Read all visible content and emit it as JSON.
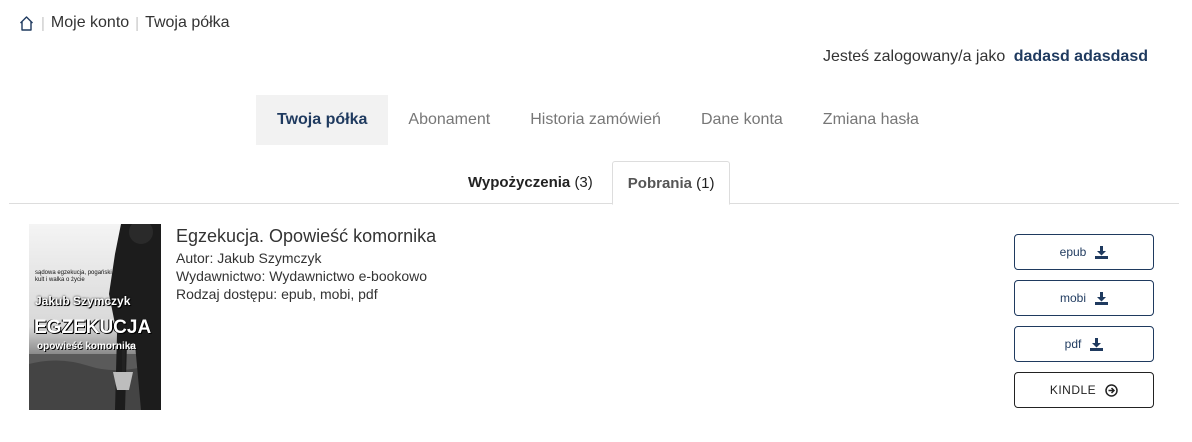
{
  "breadcrumb": {
    "home_icon": "home-icon",
    "items": [
      "Moje konto",
      "Twoja półka"
    ]
  },
  "account": {
    "logged_in_text": "Jesteś zalogowany/a jako",
    "user_name": "dadasd adasdasd"
  },
  "main_tabs": [
    {
      "label": "Twoja półka",
      "active": true
    },
    {
      "label": "Abonament",
      "active": false
    },
    {
      "label": "Historia zamówień",
      "active": false
    },
    {
      "label": "Dane konta",
      "active": false
    },
    {
      "label": "Zmiana hasła",
      "active": false
    }
  ],
  "sub_tabs": [
    {
      "label": "Wypożyczenia",
      "count": "(3)",
      "active": false
    },
    {
      "label": "Pobrania",
      "count": "(1)",
      "active": true
    }
  ],
  "book": {
    "title": "Egzekucja. Opowieść komornika",
    "author_line": "Autor: Jakub Szymczyk",
    "publisher_line": "Wydawnictwo: Wydawnictwo e-bookowo",
    "access_line": "Rodzaj dostępu: epub, mobi, pdf",
    "cover": {
      "tagline": "sądowa egzekucja, pogański kult i walka o życie",
      "author": "Jakub Szymczyk",
      "title": "EGZEKUCJA",
      "subtitle": "opowieść komornika"
    },
    "downloads": [
      {
        "label": "epub",
        "icon": "download-icon"
      },
      {
        "label": "mobi",
        "icon": "download-icon"
      },
      {
        "label": "pdf",
        "icon": "download-icon"
      }
    ],
    "kindle": {
      "label": "KINDLE",
      "icon": "arrow-circle-right-icon"
    }
  },
  "colors": {
    "accent": "#1f3a5f",
    "tab_active_bg": "#f2f2f2",
    "muted_text": "#777777",
    "border": "#dddddd"
  }
}
